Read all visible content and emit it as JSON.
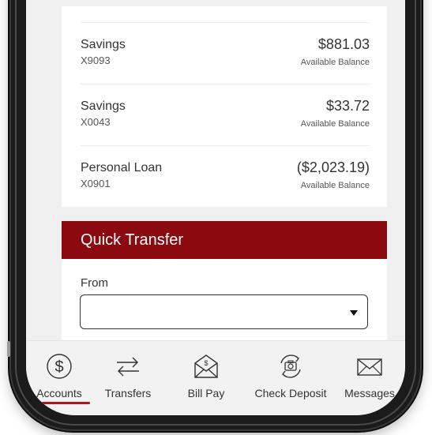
{
  "accounts": [
    {
      "name": "Savings",
      "number": "X9093",
      "amount": "$881.03",
      "balance_label": "Available Balance"
    },
    {
      "name": "Savings",
      "number": "X0043",
      "amount": "$33.72",
      "balance_label": "Available Balance"
    },
    {
      "name": "Personal Loan",
      "number": "X0901",
      "amount": "($2,023.19)",
      "balance_label": "Available Balance"
    }
  ],
  "quick_transfer": {
    "title": "Quick Transfer",
    "from_label": "From",
    "from_value": ""
  },
  "nav": {
    "items": [
      {
        "label": "Accounts",
        "icon": "dollar-circle-icon",
        "active": true
      },
      {
        "label": "Transfers",
        "icon": "transfer-arrows-icon",
        "active": false
      },
      {
        "label": "Bill Pay",
        "icon": "bill-envelope-icon",
        "active": false
      },
      {
        "label": "Check Deposit",
        "icon": "camera-deposit-icon",
        "active": false
      },
      {
        "label": "Messages",
        "icon": "envelope-icon",
        "active": false
      }
    ]
  },
  "colors": {
    "brand_red": "#8b0a10",
    "active_underline": "#b5121b",
    "nav_bg": "#f2f2f2",
    "screen_bg": "#f0f0f0"
  }
}
